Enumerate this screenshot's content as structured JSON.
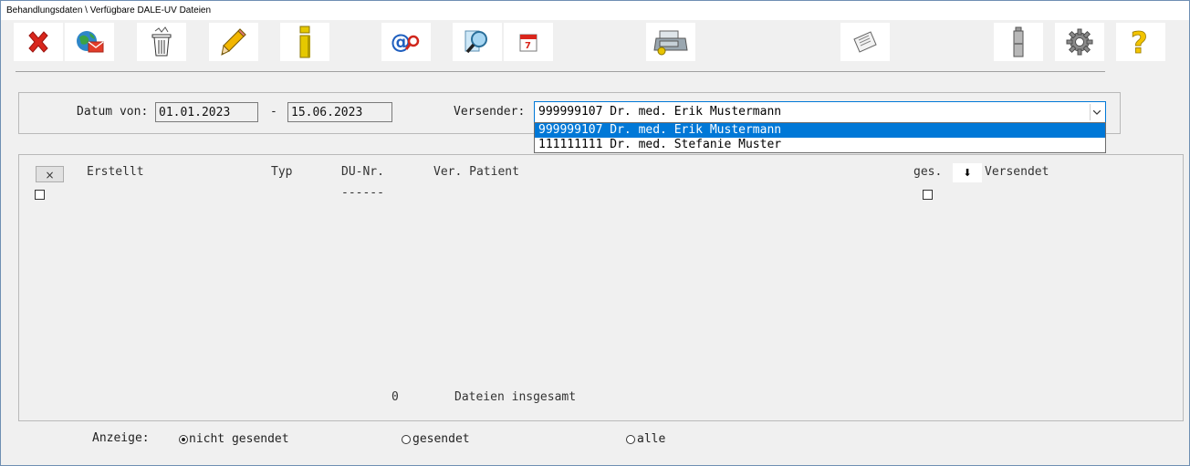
{
  "window": {
    "title": "Behandlungsdaten \\ Verfügbare DALE-UV Dateien"
  },
  "toolbar": {
    "buttons": [
      {
        "name": "close",
        "icon": "red-x-icon"
      },
      {
        "name": "send-mail",
        "icon": "globe-mail-icon"
      },
      {
        "name": "delete",
        "icon": "trash-can-icon"
      },
      {
        "name": "edit",
        "icon": "pencil-icon"
      },
      {
        "name": "info",
        "icon": "info-i-icon"
      },
      {
        "name": "search-email",
        "icon": "at-search-icon"
      },
      {
        "name": "search",
        "icon": "magnifier-icon"
      },
      {
        "name": "calendar",
        "icon": "calendar-icon"
      },
      {
        "name": "cash-register",
        "icon": "cash-register-icon"
      },
      {
        "name": "letter",
        "icon": "envelope-icon"
      },
      {
        "name": "battery",
        "icon": "battery-icon"
      },
      {
        "name": "settings",
        "icon": "gear-icon"
      },
      {
        "name": "help",
        "icon": "question-icon"
      }
    ]
  },
  "filter": {
    "date_from_label": "Datum von:",
    "date_from": "01.01.2023",
    "date_sep": "-",
    "date_to": "15.06.2023",
    "sender_label": "Versender:",
    "sender_selected": "999999107 Dr. med. Erik Mustermann",
    "sender_options": [
      "999999107 Dr. med. Erik Mustermann",
      "111111111 Dr. med. Stefanie Muster"
    ]
  },
  "table": {
    "clear_label": "×",
    "headers": {
      "erstellt": "Erstellt",
      "typ": "Typ",
      "du_nr": "DU-Nr.",
      "ver_patient": "Ver. Patient",
      "ges": "ges.",
      "sort": "⬇",
      "versendet": "Versendet"
    },
    "du_nr_placeholder": "------",
    "count": "0",
    "count_label": "Dateien insgesamt"
  },
  "display": {
    "label": "Anzeige:",
    "options": [
      "nicht gesendet",
      "gesendet",
      "alle"
    ],
    "selected": "nicht gesendet"
  }
}
